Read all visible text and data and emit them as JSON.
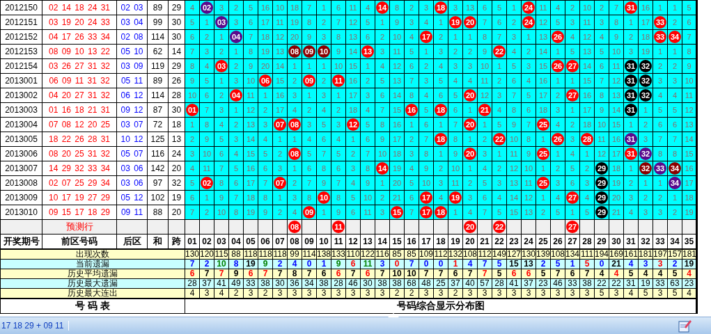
{
  "draws": [
    {
      "issue": "2012150",
      "front": "02 14 18 24 31",
      "back": "02 03",
      "sum": "89",
      "span": "29",
      "cells": [
        "4",
        {
          "ball": "02",
          "color": "#5a0a8c"
        },
        "3",
        "2",
        "5",
        "16",
        "10",
        "18",
        "7",
        "1",
        "6",
        "11",
        "4",
        {
          "ball": "14",
          "color": "#ff0000"
        },
        "8",
        "2",
        "3",
        {
          "ball": "18",
          "color": "#ff0000"
        },
        "3",
        "13",
        "6",
        "5",
        "1",
        {
          "ball": "24",
          "color": "#ff0000"
        },
        "11",
        "4",
        "2",
        "10",
        "2",
        "7",
        {
          "ball": "31",
          "color": "#ff0000"
        },
        "16",
        "1",
        "1",
        "5"
      ]
    },
    {
      "issue": "2012151",
      "front": "03 19 20 24 33",
      "back": "03 04",
      "sum": "99",
      "span": "30",
      "cells": [
        "5",
        "1",
        {
          "ball": "03",
          "color": "#5a0a8c"
        },
        "3",
        "6",
        "17",
        "11",
        "19",
        "8",
        "2",
        "7",
        "12",
        "5",
        "1",
        "9",
        "3",
        "4",
        "1",
        {
          "ball": "19",
          "color": "#ff0000"
        },
        {
          "ball": "20",
          "color": "#ff0000"
        },
        "7",
        "6",
        "2",
        {
          "ball": "24",
          "color": "#ff0000"
        },
        "12",
        "5",
        "3",
        "11",
        "3",
        "8",
        "1",
        "17",
        {
          "ball": "33",
          "color": "#ff0000"
        },
        "2",
        "6"
      ]
    },
    {
      "issue": "2012152",
      "front": "04 17 26 33 34",
      "back": "02 08",
      "sum": "114",
      "span": "30",
      "cells": [
        "6",
        "2",
        "1",
        {
          "ball": "04",
          "color": "#5a0a8c"
        },
        "7",
        "18",
        "12",
        "20",
        "9",
        "3",
        "8",
        "13",
        "6",
        "2",
        "10",
        "4",
        {
          "ball": "17",
          "color": "#ff0000"
        },
        "2",
        "1",
        "1",
        "8",
        "7",
        "3",
        "1",
        "13",
        {
          "ball": "26",
          "color": "#ff0000"
        },
        "4",
        "12",
        "4",
        "9",
        "2",
        "18",
        {
          "ball": "33",
          "color": "#ff0000"
        },
        {
          "ball": "34",
          "color": "#ff0000"
        },
        "7"
      ]
    },
    {
      "issue": "2012153",
      "front": "08 09 10 13 22",
      "back": "05 10",
      "sum": "62",
      "span": "14",
      "cells": [
        "7",
        "3",
        "2",
        "1",
        "8",
        "19",
        "13",
        {
          "ball": "08",
          "color": "#8b0000"
        },
        {
          "ball": "09",
          "color": "#8b0000"
        },
        {
          "ball": "10",
          "color": "#8b0000"
        },
        "9",
        "14",
        {
          "ball": "13",
          "color": "#ff0000"
        },
        "3",
        "11",
        "5",
        "1",
        "3",
        "2",
        "2",
        "9",
        {
          "ball": "22",
          "color": "#ff0000"
        },
        "4",
        "2",
        "14",
        "1",
        "5",
        "13",
        "5",
        "10",
        "3",
        "19",
        "1",
        "1",
        "8"
      ]
    },
    {
      "issue": "2012154",
      "front": "03 26 27 31 32",
      "back": "03 09",
      "sum": "119",
      "span": "29",
      "cells": [
        "8",
        "4",
        {
          "ball": "03",
          "color": "#ff0000"
        },
        "2",
        "9",
        "20",
        "14",
        "1",
        "1",
        "1",
        "10",
        "15",
        "1",
        "4",
        "12",
        "6",
        "2",
        "4",
        "3",
        "3",
        "10",
        "1",
        "5",
        "3",
        "15",
        {
          "ball": "26",
          "color": "#ff0000"
        },
        {
          "ball": "27",
          "color": "#ff0000"
        },
        "14",
        "6",
        "11",
        {
          "ball": "31",
          "color": "#000000"
        },
        {
          "ball": "32",
          "color": "#000000"
        },
        "2",
        "2",
        "9"
      ]
    },
    {
      "issue": "2013001",
      "front": "06 09 11 31 32",
      "back": "05 11",
      "sum": "89",
      "span": "26",
      "cells": [
        "9",
        "5",
        "1",
        "3",
        "10",
        {
          "ball": "06",
          "color": "#ff0000"
        },
        "15",
        "2",
        {
          "ball": "09",
          "color": "#ff0000"
        },
        "2",
        {
          "ball": "11",
          "color": "#ff0000"
        },
        "16",
        "2",
        "5",
        "13",
        "7",
        "3",
        "5",
        "4",
        "4",
        "11",
        "2",
        "6",
        "4",
        "16",
        "1",
        "1",
        "15",
        "7",
        "12",
        {
          "ball": "31",
          "color": "#000000"
        },
        {
          "ball": "32",
          "color": "#000000"
        },
        "3",
        "3",
        "10"
      ]
    },
    {
      "issue": "2013002",
      "front": "04 20 27 31 32",
      "back": "06 12",
      "sum": "114",
      "span": "28",
      "cells": [
        "10",
        "6",
        "2",
        {
          "ball": "04",
          "color": "#ff0000"
        },
        "11",
        "1",
        "16",
        "3",
        "1",
        "3",
        "1",
        "17",
        "3",
        "6",
        "14",
        "8",
        "4",
        "6",
        "5",
        {
          "ball": "20",
          "color": "#ff0000"
        },
        "12",
        "3",
        "7",
        "5",
        "17",
        "2",
        {
          "ball": "27",
          "color": "#ff0000"
        },
        "16",
        "8",
        "13",
        {
          "ball": "31",
          "color": "#000000"
        },
        {
          "ball": "32",
          "color": "#000000"
        },
        "4",
        "4",
        "11"
      ]
    },
    {
      "issue": "2013003",
      "front": "01 16 18 21 31",
      "back": "09 12",
      "sum": "87",
      "span": "30",
      "cells": [
        {
          "ball": "01",
          "color": "#ff0000"
        },
        "7",
        "3",
        "1",
        "12",
        "2",
        "17",
        "4",
        "2",
        "4",
        "2",
        "18",
        "4",
        "7",
        "15",
        {
          "ball": "16",
          "color": "#ff0000"
        },
        "5",
        {
          "ball": "18",
          "color": "#ff0000"
        },
        "6",
        "1",
        {
          "ball": "21",
          "color": "#ff0000"
        },
        "4",
        "8",
        "6",
        "18",
        "3",
        "1",
        "17",
        "9",
        "14",
        {
          "ball": "31",
          "color": "#000000"
        },
        "1",
        "5",
        "5",
        "12"
      ]
    },
    {
      "issue": "2013004",
      "front": "07 08 12 20 25",
      "back": "03 07",
      "sum": "72",
      "span": "18",
      "cells": [
        "1",
        "8",
        "4",
        "2",
        "13",
        "3",
        {
          "ball": "07",
          "color": "#ff0000"
        },
        {
          "ball": "08",
          "color": "#ff0000"
        },
        "3",
        "5",
        "3",
        {
          "ball": "12",
          "color": "#ff0000"
        },
        "5",
        "8",
        "16",
        "1",
        "6",
        "1",
        "7",
        {
          "ball": "20",
          "color": "#ff0000"
        },
        "1",
        "5",
        "9",
        "7",
        {
          "ball": "25",
          "color": "#ff0000"
        },
        "4",
        "2",
        "18",
        "10",
        "15",
        "1",
        "2",
        "6",
        "6",
        "13"
      ]
    },
    {
      "issue": "2013005",
      "front": "18 22 26 28 31",
      "back": "10 12",
      "sum": "125",
      "span": "13",
      "cells": [
        "2",
        "9",
        "5",
        "3",
        "14",
        "4",
        "1",
        "1",
        "4",
        "6",
        "4",
        "1",
        "6",
        "9",
        "17",
        "2",
        "7",
        {
          "ball": "18",
          "color": "#ff0000"
        },
        "8",
        "1",
        "2",
        {
          "ball": "22",
          "color": "#ff0000"
        },
        "10",
        "8",
        "1",
        {
          "ball": "26",
          "color": "#ff0000"
        },
        "3",
        {
          "ball": "28",
          "color": "#ff0000"
        },
        "11",
        "16",
        {
          "ball": "31",
          "color": "#5a0a8c"
        },
        "3",
        "7",
        "7",
        "14"
      ]
    },
    {
      "issue": "2013006",
      "front": "08 20 25 31 32",
      "back": "05 07",
      "sum": "116",
      "span": "24",
      "cells": [
        "3",
        "10",
        "6",
        "4",
        "15",
        "5",
        "2",
        {
          "ball": "08",
          "color": "#ff0000"
        },
        "5",
        "7",
        "5",
        "2",
        "7",
        "10",
        "18",
        "3",
        "8",
        "1",
        "9",
        {
          "ball": "20",
          "color": "#ff0000"
        },
        "3",
        "1",
        "11",
        "9",
        {
          "ball": "25",
          "color": "#ff0000"
        },
        "1",
        "4",
        "1",
        "12",
        "17",
        {
          "ball": "31",
          "color": "#ff0000"
        },
        {
          "ball": "32",
          "color": "#5a0a8c"
        },
        "8",
        "8",
        "15"
      ]
    },
    {
      "issue": "2013007",
      "front": "14 29 32 33 34",
      "back": "03 06",
      "sum": "142",
      "span": "20",
      "cells": [
        "4",
        "11",
        "7",
        "5",
        "16",
        "6",
        "3",
        "1",
        "6",
        "8",
        "6",
        "3",
        "8",
        {
          "ball": "14",
          "color": "#ff0000"
        },
        "19",
        "4",
        "9",
        "2",
        "10",
        "1",
        "4",
        "2",
        "12",
        "10",
        "1",
        "2",
        "5",
        "2",
        {
          "ball": "29",
          "color": "#000000"
        },
        "18",
        "1",
        {
          "ball": "32",
          "color": "#8b0000"
        },
        {
          "ball": "33",
          "color": "#5a0a8c"
        },
        {
          "ball": "34",
          "color": "#8b0000"
        },
        "16"
      ]
    },
    {
      "issue": "2013008",
      "front": "02 07 25 29 34",
      "back": "03 06",
      "sum": "97",
      "span": "32",
      "cells": [
        "5",
        {
          "ball": "02",
          "color": "#ff0000"
        },
        "8",
        "6",
        "17",
        "7",
        {
          "ball": "07",
          "color": "#ff0000"
        },
        "2",
        "7",
        "9",
        "7",
        "4",
        "9",
        "1",
        "20",
        "5",
        "10",
        "3",
        "11",
        "2",
        "5",
        "3",
        "13",
        "11",
        {
          "ball": "25",
          "color": "#ff0000"
        },
        "3",
        "6",
        "3",
        {
          "ball": "29",
          "color": "#000000"
        },
        "19",
        "2",
        "1",
        "1",
        {
          "ball": "34",
          "color": "#5a0a8c"
        },
        "17"
      ]
    },
    {
      "issue": "2013009",
      "front": "10 17 19 27 29",
      "back": "05 12",
      "sum": "102",
      "span": "19",
      "cells": [
        "6",
        "1",
        "9",
        "7",
        "18",
        "8",
        "1",
        "3",
        "8",
        {
          "ball": "10",
          "color": "#ff0000"
        },
        "8",
        "5",
        "10",
        "2",
        "21",
        "6",
        {
          "ball": "17",
          "color": "#ff0000"
        },
        "4",
        {
          "ball": "19",
          "color": "#ff0000"
        },
        "3",
        "6",
        "4",
        "14",
        "12",
        "1",
        "4",
        {
          "ball": "27",
          "color": "#ff0000"
        },
        "4",
        {
          "ball": "29",
          "color": "#000000"
        },
        "20",
        "3",
        "2",
        "2",
        "1",
        "18"
      ]
    },
    {
      "issue": "2013010",
      "front": "09 15 17 18 29",
      "back": "09 11",
      "sum": "88",
      "span": "20",
      "cells": [
        "7",
        "2",
        "10",
        "8",
        "19",
        "9",
        "2",
        "4",
        {
          "ball": "09",
          "color": "#ff0000"
        },
        "1",
        "9",
        "6",
        "11",
        "3",
        {
          "ball": "15",
          "color": "#ff0000"
        },
        "7",
        {
          "ball": "17",
          "color": "#ff0000"
        },
        {
          "ball": "18",
          "color": "#ff0000"
        },
        "1",
        "4",
        "7",
        "5",
        "15",
        "13",
        "2",
        "5",
        "1",
        "5",
        {
          "ball": "29",
          "color": "#000000"
        },
        "21",
        "4",
        "3",
        "3",
        "2",
        "19"
      ]
    }
  ],
  "prediction": {
    "label": "预测行",
    "cells": [
      null,
      null,
      null,
      null,
      null,
      null,
      null,
      {
        "ball": "08",
        "color": "#ff0000"
      },
      null,
      null,
      {
        "ball": "11",
        "color": "#ff0000"
      },
      null,
      null,
      null,
      null,
      null,
      null,
      null,
      null,
      {
        "ball": "20",
        "color": "#ff0000"
      },
      null,
      {
        "ball": "22",
        "color": "#ff0000"
      },
      null,
      null,
      null,
      null,
      {
        "ball": "27",
        "color": "#ff0000"
      },
      null,
      null,
      null,
      null,
      null,
      null,
      null,
      null
    ]
  },
  "header": {
    "columns": [
      "开奖期号",
      "前区号码",
      "后区",
      "和",
      "跨"
    ],
    "numbers": [
      "01",
      "02",
      "03",
      "04",
      "05",
      "06",
      "07",
      "08",
      "09",
      "10",
      "11",
      "12",
      "13",
      "14",
      "15",
      "16",
      "17",
      "18",
      "19",
      "20",
      "21",
      "22",
      "23",
      "24",
      "25",
      "26",
      "27",
      "28",
      "29",
      "30",
      "31",
      "32",
      "33",
      "34",
      "35"
    ]
  },
  "stats": [
    {
      "label": "出现次数",
      "values": [
        "130",
        "120",
        "115",
        "88",
        "118",
        "118",
        "118",
        "99",
        "114",
        "138",
        "133",
        "110",
        "122",
        "116",
        "85",
        "85",
        "109",
        "112",
        "132",
        "108",
        "112",
        "149",
        "127",
        "130",
        "139",
        "108",
        "134",
        "111",
        "194",
        "169",
        "161",
        "181",
        "197",
        "157",
        "181"
      ]
    },
    {
      "label": "当前遗漏",
      "values": [
        {
          "text": "7",
          "color": "#0000ff"
        },
        {
          "text": "2",
          "color": "#0000ff"
        },
        {
          "text": "10",
          "color": "#008000"
        },
        {
          "text": "8",
          "color": "#0000ff"
        },
        {
          "text": "19",
          "color": "#000000"
        },
        {
          "text": "9",
          "color": "#008000"
        },
        {
          "text": "2",
          "color": "#0000ff"
        },
        {
          "text": "4",
          "color": "#0000ff"
        },
        {
          "text": "0",
          "color": "#0000ff"
        },
        {
          "text": "1",
          "color": "#0000ff"
        },
        {
          "text": "9",
          "color": "#008000"
        },
        {
          "text": "6",
          "color": "#ff0000"
        },
        {
          "text": "11",
          "color": "#008000"
        },
        {
          "text": "3",
          "color": "#0000ff"
        },
        {
          "text": "0",
          "color": "#ff0000"
        },
        {
          "text": "7",
          "color": "#0000ff"
        },
        {
          "text": "0",
          "color": "#0000ff"
        },
        {
          "text": "0",
          "color": "#0000ff"
        },
        {
          "text": "1",
          "color": "#ff0000"
        },
        {
          "text": "4",
          "color": "#0000ff"
        },
        {
          "text": "7",
          "color": "#0000ff"
        },
        {
          "text": "5",
          "color": "#0000ff"
        },
        {
          "text": "15",
          "color": "#000000"
        },
        {
          "text": "13",
          "color": "#000000"
        },
        {
          "text": "2",
          "color": "#0000ff"
        },
        {
          "text": "5",
          "color": "#0000ff"
        },
        {
          "text": "1",
          "color": "#0000ff"
        },
        {
          "text": "5",
          "color": "#ff0000"
        },
        {
          "text": "0",
          "color": "#0000ff"
        },
        {
          "text": "21",
          "color": "#000000"
        },
        {
          "text": "4",
          "color": "#0000ff"
        },
        {
          "text": "3",
          "color": "#0000ff"
        },
        {
          "text": "3",
          "color": "#ff0000"
        },
        {
          "text": "2",
          "color": "#0000ff"
        },
        {
          "text": "19",
          "color": "#000000"
        }
      ]
    },
    {
      "label": "历史平均遗漏",
      "values": [
        {
          "text": "6",
          "color": "#ff0000"
        },
        {
          "text": "7",
          "color": "#000000"
        },
        {
          "text": "7",
          "color": "#ff0000"
        },
        {
          "text": "9",
          "color": "#000000"
        },
        {
          "text": "6",
          "color": "#ff0000"
        },
        {
          "text": "7",
          "color": "#ff0000"
        },
        {
          "text": "7",
          "color": "#000000"
        },
        {
          "text": "8",
          "color": "#000000"
        },
        {
          "text": "7",
          "color": "#000000"
        },
        {
          "text": "6",
          "color": "#000000"
        },
        {
          "text": "6",
          "color": "#ff0000"
        },
        {
          "text": "7",
          "color": "#000000"
        },
        {
          "text": "6",
          "color": "#ff0000"
        },
        {
          "text": "7",
          "color": "#000000"
        },
        {
          "text": "10",
          "color": "#000000"
        },
        {
          "text": "10",
          "color": "#000000"
        },
        {
          "text": "7",
          "color": "#000000"
        },
        {
          "text": "7",
          "color": "#000000"
        },
        {
          "text": "6",
          "color": "#000000"
        },
        {
          "text": "7",
          "color": "#000000"
        },
        {
          "text": "7",
          "color": "#ff0000"
        },
        {
          "text": "5",
          "color": "#000000"
        },
        {
          "text": "6",
          "color": "#ff0000"
        },
        {
          "text": "6",
          "color": "#ff0000"
        },
        {
          "text": "5",
          "color": "#000000"
        },
        {
          "text": "7",
          "color": "#000000"
        },
        {
          "text": "6",
          "color": "#000000"
        },
        {
          "text": "7",
          "color": "#000000"
        },
        {
          "text": "4",
          "color": "#000000"
        },
        {
          "text": "4",
          "color": "#ff0000"
        },
        {
          "text": "5",
          "color": "#000000"
        },
        {
          "text": "4",
          "color": "#000000"
        },
        {
          "text": "4",
          "color": "#000000"
        },
        {
          "text": "5",
          "color": "#000000"
        },
        {
          "text": "4",
          "color": "#ff0000"
        }
      ]
    },
    {
      "label": "历史最大遗漏",
      "values": [
        "28",
        "37",
        "41",
        "49",
        "33",
        "38",
        "30",
        "36",
        "34",
        "38",
        "28",
        "46",
        "30",
        "38",
        "38",
        "68",
        "48",
        "25",
        "37",
        "40",
        "57",
        "28",
        "41",
        "37",
        "23",
        "46",
        "33",
        "38",
        "22",
        "22",
        "31",
        "19",
        "33",
        "63",
        "23"
      ]
    },
    {
      "label": "历史最大连出",
      "values": [
        "4",
        "3",
        "4",
        "2",
        "3",
        "2",
        "3",
        "3",
        "3",
        "3",
        "3",
        "3",
        "3",
        "3",
        "2",
        "2",
        "3",
        "3",
        "2",
        "3",
        "3",
        "3",
        "3",
        "3",
        "3",
        "3",
        "3",
        "3",
        "5",
        "3",
        "4",
        "5",
        "3",
        "5",
        "4"
      ]
    }
  ],
  "footer": {
    "left": "号 码 表",
    "right": "号码综合显示分布图"
  },
  "status_bar": {
    "text": "17 18 29 + 09 11"
  }
}
